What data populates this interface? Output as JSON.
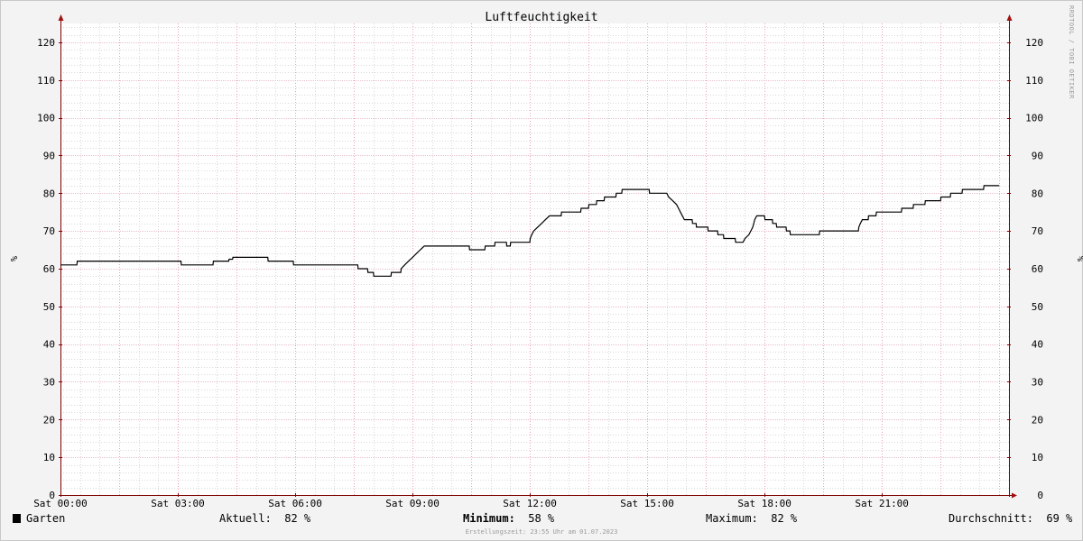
{
  "chart_data": {
    "type": "line",
    "title": "Luftfeuchtigkeit",
    "ylabel": "%",
    "ylim": [
      0,
      125
    ],
    "yticks": [
      0,
      10,
      20,
      30,
      40,
      50,
      60,
      70,
      80,
      90,
      100,
      110,
      120
    ],
    "xlim": [
      0,
      24.25
    ],
    "xticks": [
      {
        "h": 0,
        "label": "Sat 00:00"
      },
      {
        "h": 3,
        "label": "Sat 03:00"
      },
      {
        "h": 6,
        "label": "Sat 06:00"
      },
      {
        "h": 9,
        "label": "Sat 09:00"
      },
      {
        "h": 12,
        "label": "Sat 12:00"
      },
      {
        "h": 15,
        "label": "Sat 15:00"
      },
      {
        "h": 18,
        "label": "Sat 18:00"
      },
      {
        "h": 21,
        "label": "Sat 21:00"
      }
    ],
    "grid": true,
    "series": [
      {
        "name": "Garten",
        "color": "#000000",
        "points": [
          [
            0.0,
            61
          ],
          [
            0.42,
            61
          ],
          [
            0.43,
            62
          ],
          [
            3.08,
            62
          ],
          [
            3.09,
            61
          ],
          [
            3.9,
            61
          ],
          [
            3.91,
            62
          ],
          [
            4.3,
            62
          ],
          [
            4.31,
            62.5
          ],
          [
            4.4,
            62.5
          ],
          [
            4.41,
            63
          ],
          [
            5.3,
            63
          ],
          [
            5.31,
            62
          ],
          [
            5.95,
            62
          ],
          [
            5.96,
            61
          ],
          [
            7.6,
            61
          ],
          [
            7.61,
            60
          ],
          [
            7.85,
            60
          ],
          [
            7.86,
            59
          ],
          [
            8.0,
            59
          ],
          [
            8.01,
            58
          ],
          [
            8.45,
            58
          ],
          [
            8.46,
            59
          ],
          [
            8.7,
            59
          ],
          [
            8.71,
            60
          ],
          [
            8.8,
            61
          ],
          [
            8.9,
            62
          ],
          [
            9.0,
            63
          ],
          [
            9.1,
            64
          ],
          [
            9.2,
            65
          ],
          [
            9.3,
            66
          ],
          [
            10.45,
            66
          ],
          [
            10.46,
            65
          ],
          [
            10.85,
            65
          ],
          [
            10.86,
            66
          ],
          [
            11.1,
            66
          ],
          [
            11.11,
            67
          ],
          [
            11.4,
            67
          ],
          [
            11.41,
            66
          ],
          [
            11.5,
            66
          ],
          [
            11.51,
            67
          ],
          [
            12.0,
            67
          ],
          [
            12.01,
            68
          ],
          [
            12.05,
            69
          ],
          [
            12.1,
            70
          ],
          [
            12.2,
            71
          ],
          [
            12.3,
            72
          ],
          [
            12.4,
            73
          ],
          [
            12.5,
            74
          ],
          [
            12.8,
            74
          ],
          [
            12.81,
            75
          ],
          [
            13.3,
            75
          ],
          [
            13.31,
            76
          ],
          [
            13.5,
            76
          ],
          [
            13.51,
            77
          ],
          [
            13.7,
            77
          ],
          [
            13.71,
            78
          ],
          [
            13.9,
            78
          ],
          [
            13.91,
            79
          ],
          [
            14.2,
            79
          ],
          [
            14.21,
            80
          ],
          [
            14.35,
            80
          ],
          [
            14.36,
            81
          ],
          [
            15.05,
            81
          ],
          [
            15.06,
            80
          ],
          [
            15.5,
            80
          ],
          [
            15.55,
            79
          ],
          [
            15.65,
            78
          ],
          [
            15.75,
            77
          ],
          [
            15.8,
            76
          ],
          [
            15.85,
            75
          ],
          [
            15.9,
            74
          ],
          [
            15.95,
            73
          ],
          [
            16.15,
            73
          ],
          [
            16.16,
            72
          ],
          [
            16.25,
            72
          ],
          [
            16.26,
            71
          ],
          [
            16.55,
            71
          ],
          [
            16.56,
            70
          ],
          [
            16.8,
            70
          ],
          [
            16.81,
            69
          ],
          [
            16.95,
            69
          ],
          [
            16.96,
            68
          ],
          [
            17.25,
            68
          ],
          [
            17.26,
            67
          ],
          [
            17.45,
            67
          ],
          [
            17.5,
            68
          ],
          [
            17.6,
            69
          ],
          [
            17.7,
            71
          ],
          [
            17.75,
            73
          ],
          [
            17.8,
            74
          ],
          [
            18.0,
            74
          ],
          [
            18.01,
            73
          ],
          [
            18.2,
            73
          ],
          [
            18.21,
            72
          ],
          [
            18.3,
            72
          ],
          [
            18.31,
            71
          ],
          [
            18.55,
            71
          ],
          [
            18.56,
            70
          ],
          [
            18.65,
            70
          ],
          [
            18.66,
            69
          ],
          [
            19.4,
            69
          ],
          [
            19.41,
            70
          ],
          [
            20.4,
            70
          ],
          [
            20.41,
            71
          ],
          [
            20.45,
            72
          ],
          [
            20.5,
            73
          ],
          [
            20.65,
            73
          ],
          [
            20.66,
            74
          ],
          [
            20.85,
            74
          ],
          [
            20.86,
            75
          ],
          [
            21.5,
            75
          ],
          [
            21.51,
            76
          ],
          [
            21.8,
            76
          ],
          [
            21.81,
            77
          ],
          [
            22.1,
            77
          ],
          [
            22.11,
            78
          ],
          [
            22.5,
            78
          ],
          [
            22.51,
            79
          ],
          [
            22.75,
            79
          ],
          [
            22.76,
            80
          ],
          [
            23.05,
            80
          ],
          [
            23.06,
            81
          ],
          [
            23.6,
            81
          ],
          [
            23.61,
            82
          ],
          [
            24.0,
            82
          ]
        ]
      }
    ]
  },
  "watermark": "RRDTOOL / TOBI OETIKER",
  "legend": {
    "series_name": "Garten",
    "current_label": "Aktuell:",
    "current_value": "82 %",
    "min_label": "Minimum:",
    "min_value": "58 %",
    "max_label": "Maximum:",
    "max_value": "82 %",
    "avg_label": "Durchschnitt:",
    "avg_value": "69 %"
  },
  "footer": "Erstellungszeit: 23:55 Uhr am 01.07.2023",
  "colors": {
    "plot_bg": "#ffffff",
    "page_bg": "#f3f3f3",
    "minor_grid": "#d8d8d8",
    "major_grid_x": "#f0a0b0",
    "axis": "#800000",
    "arrow": "#a01010"
  }
}
